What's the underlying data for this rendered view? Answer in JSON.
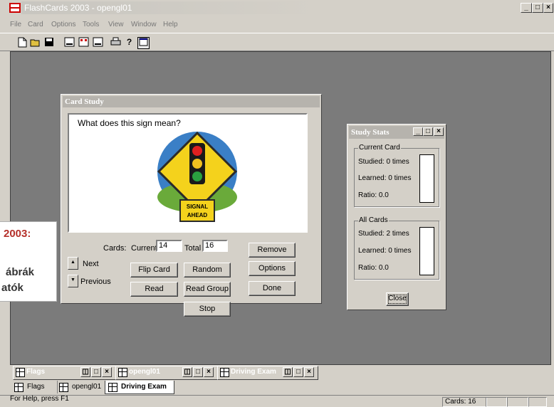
{
  "app": {
    "title": "FlashCards 2003 - opengl01",
    "controls": [
      "_",
      "□",
      "×"
    ]
  },
  "menu": [
    "File",
    "Card",
    "Options",
    "Tools",
    "View",
    "Window",
    "Help"
  ],
  "toolbar": {
    "icons": [
      "new-file-icon",
      "open-folder-icon",
      "save-icon",
      "card-view-icon",
      "card-grid-icon",
      "card-list-icon",
      "print-icon",
      "help-icon",
      "window-icon"
    ]
  },
  "card_study": {
    "title": "Card Study",
    "question": "What does this sign mean?",
    "sign_text": [
      "SIGNAL",
      "AHEAD"
    ],
    "cards_label": "Cards:",
    "current_label": "Current",
    "current_value": "14",
    "total_label": "Total",
    "total_value": "16",
    "next_label": "Next",
    "previous_label": "Previous",
    "buttons": {
      "flip": "Flip Card",
      "random": "Random",
      "read": "Read",
      "read_group": "Read Group",
      "stop": "Stop",
      "remove": "Remove",
      "options": "Options",
      "done": "Done"
    }
  },
  "study_stats": {
    "title": "Study Stats",
    "current_card": {
      "group": "Current Card",
      "studied": "Studied: 0 times",
      "learned": "Learned: 0 times",
      "ratio": "Ratio: 0.0",
      "ratio_value": 0
    },
    "all_cards": {
      "group": "All Cards",
      "studied": "Studied: 2 times",
      "learned": "Learned: 0 times",
      "ratio": "Ratio: 0.0",
      "ratio_value": 0
    },
    "close": "Close"
  },
  "overlay": {
    "line1": "2003:",
    "line2": "ábrák",
    "line3": "atók"
  },
  "minimized_windows": [
    "Flags",
    "opengl01",
    "Driving Exam"
  ],
  "tabs": [
    "Flags",
    "opengl01",
    "Driving Exam"
  ],
  "active_tab": "Driving Exam",
  "status": {
    "help": "For Help, press F1",
    "cards": "Cards: 16"
  }
}
